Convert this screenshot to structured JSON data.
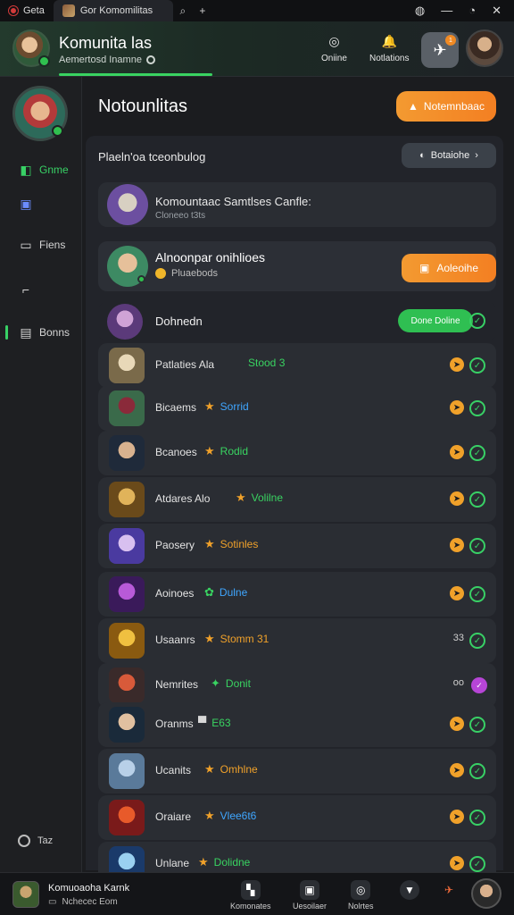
{
  "titlebar": {
    "app": "Geta",
    "tab": "Gor Komomilitas",
    "icons": [
      "search-icon",
      "plus-icon"
    ],
    "right_icons": [
      "github-icon",
      "minimize-icon",
      "help-icon",
      "close-icon"
    ]
  },
  "header": {
    "title": "Komunita  las",
    "subtitle": "Aemertosd Inamne",
    "online_label": "Oniine",
    "notifications_label": "Notlations",
    "feature_badge": "1"
  },
  "sidebar": {
    "items": [
      {
        "label": "Gnme",
        "icon": "controller-icon",
        "active": true
      },
      {
        "label": "",
        "icon": "book-icon"
      },
      {
        "label": "Fiens",
        "icon": "screen-icon"
      },
      {
        "label": "",
        "icon": "gun-icon"
      },
      {
        "label": "Bonns",
        "icon": "shop-icon",
        "marker": true
      }
    ],
    "footer_label": "Taz"
  },
  "main": {
    "title": "Notounlitas",
    "primary_button": "Notemnbaac",
    "section_title": "Plaeln'oa tceonbulog",
    "section_button": "Botaiohe",
    "card1": {
      "title": "Komountaac Samtlses Canfle:",
      "subtitle": "Cloneeo t3ts"
    },
    "card2": {
      "title": "Alnoonpar onihlioes",
      "subtitle": "Pluaebods",
      "button": "Aoleoihe"
    },
    "card3": {
      "name": "Dohnedn",
      "pill": "Done Doline"
    },
    "rows": [
      {
        "name": "Patlaties  Ala",
        "tag": "Stood 3",
        "tag_color": "#39d361",
        "icon": "none"
      },
      {
        "name": "Bicaems",
        "tag": "Sorrid",
        "tag_color": "#3fa6ff",
        "icon": "star-icon"
      },
      {
        "name": "Bcanoes",
        "tag": "Rodid",
        "tag_color": "#39d361",
        "icon": "star-icon"
      },
      {
        "name": "Atdares  Alo",
        "tag": "Volilne",
        "tag_color": "#39d361",
        "icon": "star-icon"
      },
      {
        "name": "Paosery",
        "tag": "Sotinles",
        "tag_color": "#f0a12a",
        "icon": "star-icon"
      },
      {
        "name": "Aoinoes",
        "tag": "Dulne",
        "tag_color": "#3fa6ff",
        "icon": "gear-icon"
      },
      {
        "name": "Usaanrs",
        "tag": "Stomm 31",
        "tag_color": "#f0a12a",
        "icon": "star-icon",
        "right_text": "33"
      },
      {
        "name": "Nemrites",
        "tag": "Donit",
        "tag_color": "#39d361",
        "icon": "leaf-icon",
        "right_text": "oo",
        "purple": true
      },
      {
        "name": "Oranms",
        "tag": "E63",
        "tag_color": "#39d361",
        "icon": "flag-icon"
      },
      {
        "name": "Ucanits",
        "tag": "Omhlne",
        "tag_color": "#f0a12a",
        "icon": "star-icon"
      },
      {
        "name": "Oraiare",
        "tag": "Vlee6t6",
        "tag_color": "#3fa6ff",
        "icon": "star-icon"
      },
      {
        "name": "Unlane",
        "tag": "Dolidne",
        "tag_color": "#39d361",
        "icon": "star-icon"
      }
    ]
  },
  "bottombar": {
    "line1": "Komuoaoha Karnk",
    "line2": "Nchecec Eom",
    "nav": [
      "Komonates",
      "Uesoilaer",
      "Nolrtes"
    ]
  }
}
